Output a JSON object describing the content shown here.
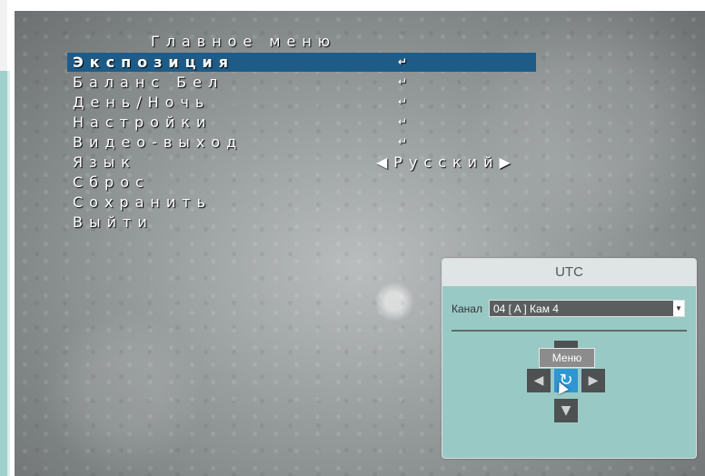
{
  "osd": {
    "title": "Главное меню",
    "items": [
      {
        "label": "Экспозиция",
        "enter": "↵",
        "value": ""
      },
      {
        "label": "Баланс Бел",
        "enter": "↵",
        "value": ""
      },
      {
        "label": "День/Ночь",
        "enter": "↵",
        "value": ""
      },
      {
        "label": "Настройки",
        "enter": "↵",
        "value": ""
      },
      {
        "label": "Видео-выход",
        "enter": "↵",
        "value": ""
      },
      {
        "label": "Язык",
        "enter": "",
        "value": "◀Русский▶"
      },
      {
        "label": "Сброс",
        "enter": "",
        "value": ""
      },
      {
        "label": "Сохранить",
        "enter": "",
        "value": ""
      },
      {
        "label": "Выйти",
        "enter": "",
        "value": ""
      }
    ],
    "selected_index": 0
  },
  "ptz_panel": {
    "title": "UTC",
    "channel_label": "Канал",
    "channel_value": "04 [ A ] Кам 4",
    "tooltip": "Меню",
    "buttons": {
      "up": "▲",
      "down": "▼",
      "left": "◀",
      "right": "▶",
      "center": "↻"
    }
  },
  "colors": {
    "selection": "#1e5c87",
    "panel_bg": "#99c9c5",
    "center_button": "#2f95d3"
  }
}
